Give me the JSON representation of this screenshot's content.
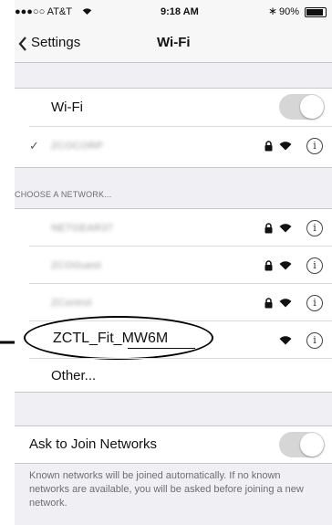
{
  "status_bar": {
    "carrier": "●●●○○ AT&T",
    "time": "9:18 AM",
    "battery": "90%"
  },
  "nav": {
    "back_label": "Settings",
    "title": "Wi-Fi"
  },
  "wifi_toggle": {
    "label": "Wi-Fi",
    "enabled": false
  },
  "connected_network": {
    "name": "ZCOCORP"
  },
  "section_header": "CHOOSE A NETWORK...",
  "networks": [
    {
      "name": "NETGEAR37",
      "locked": true
    },
    {
      "name": "ZCOGuest",
      "locked": true
    },
    {
      "name": "ZControl",
      "locked": true
    },
    {
      "name": "ZCTL_Fit_MW6M",
      "locked": false,
      "highlighted": true
    }
  ],
  "other_label": "Other...",
  "ask_to_join": {
    "label": "Ask to Join Networks",
    "enabled": false
  },
  "footer": "Known networks will be joined automatically. If no known networks are available, you will be asked before joining a new network.",
  "colors": {
    "toggle_off": "#d6d6d6",
    "background": "#efeff4",
    "tint": "#111111"
  }
}
